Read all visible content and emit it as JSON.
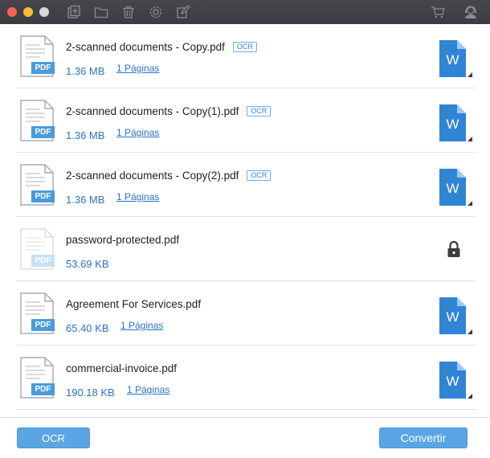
{
  "titlebar": {
    "icons": [
      "add-file-icon",
      "folder-icon",
      "trash-icon",
      "settings-icon",
      "edit-icon",
      "cart-icon",
      "support-icon"
    ]
  },
  "files": [
    {
      "name": "2-scanned documents - Copy.pdf",
      "ocr": "OCR",
      "size": "1.36 MB",
      "pages": "1 Páginas",
      "locked": false
    },
    {
      "name": "2-scanned documents - Copy(1).pdf",
      "ocr": "OCR",
      "size": "1.36 MB",
      "pages": "1 Páginas",
      "locked": false
    },
    {
      "name": "2-scanned documents - Copy(2).pdf",
      "ocr": "OCR",
      "size": "1.36 MB",
      "pages": "1 Páginas",
      "locked": false
    },
    {
      "name": "password-protected.pdf",
      "ocr": "",
      "size": "53.69 KB",
      "pages": "",
      "locked": true
    },
    {
      "name": "Agreement For Services.pdf",
      "ocr": "",
      "size": "65.40 KB",
      "pages": "1 Páginas",
      "locked": false
    },
    {
      "name": "commercial-invoice.pdf",
      "ocr": "",
      "size": "190.18 KB",
      "pages": "1 Páginas",
      "locked": false
    }
  ],
  "pdf_badge": "PDF",
  "word_badge": "W",
  "footer": {
    "ocr_label": "OCR",
    "convert_label": "Convertir"
  },
  "colors": {
    "accent": "#5aa5e4",
    "link": "#2a72c8",
    "word": "#2f84d4",
    "pdf_badge": "#4a9bdc"
  }
}
